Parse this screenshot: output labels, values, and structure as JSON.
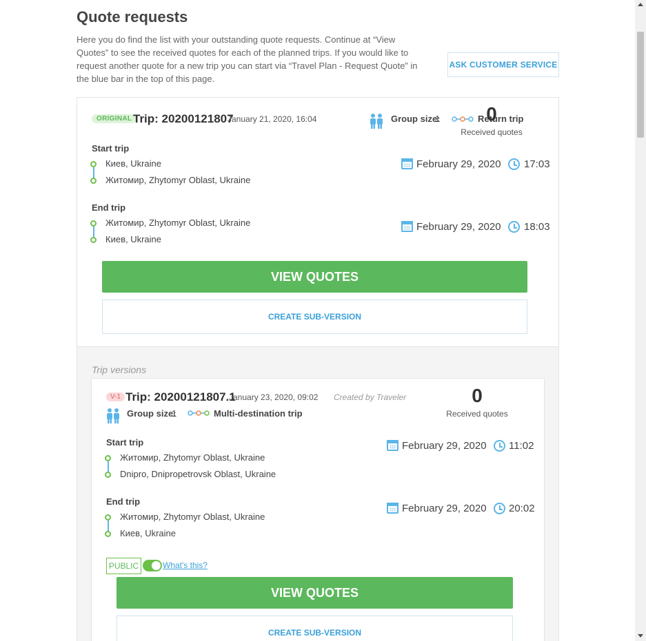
{
  "page": {
    "title": "Quote requests",
    "intro": "Here you do find the list with your outstanding quote requests. Continue at “View Quotes” to see the received quotes for each of the planned trips. If you would like to request another quote for a new trip you can start via “Travel Plan - Request Quote” in the blue bar in the top of this page.",
    "customer_service_label": "ASK CUSTOMER SERVICE"
  },
  "trip": {
    "badge": "ORIGINAL",
    "title": "Trip: 20200121807",
    "date": "January 21, 2020, 16:04",
    "group_size_label": "Group size:",
    "group_size_value": "1",
    "trip_type": "Return trip",
    "received_quotes_count": "0",
    "received_quotes_label": "Received quotes",
    "start": {
      "label": "Start trip",
      "stops": [
        "Киев, Ukraine",
        "Житомир, Zhytomyr Oblast, Ukraine"
      ],
      "date": "February 29, 2020",
      "time": "17:03"
    },
    "end": {
      "label": "End trip",
      "stops": [
        "Житомир, Zhytomyr Oblast, Ukraine",
        "Киев, Ukraine"
      ],
      "date": "February 29, 2020",
      "time": "18:03"
    },
    "view_quotes_label": "VIEW QUOTES",
    "create_sub_version_label": "CREATE SUB-VERSION"
  },
  "versions": {
    "label": "Trip versions",
    "items": [
      {
        "badge": "V-1",
        "title": "Trip: 20200121807.1",
        "date": "January 23, 2020, 09:02",
        "created_by": "Created by Traveler",
        "group_size_label": "Group size:",
        "group_size_value": "1",
        "trip_type": "Multi-destination trip",
        "received_quotes_count": "0",
        "received_quotes_label": "Received quotes",
        "start": {
          "label": "Start trip",
          "stops": [
            "Житомир, Zhytomyr Oblast, Ukraine",
            "Dnipro, Dnipropetrovsk Oblast, Ukraine"
          ],
          "date": "February 29, 2020",
          "time": "11:02"
        },
        "end": {
          "label": "End trip",
          "stops": [
            "Житомир, Zhytomyr Oblast, Ukraine",
            "Киев, Ukraine"
          ],
          "date": "February 29, 2020",
          "time": "20:02"
        },
        "public_label": "PUBLIC",
        "public_enabled": true,
        "whats_this_label": "What's this?",
        "view_quotes_label": "VIEW QUOTES",
        "create_sub_version_label": "CREATE SUB-VERSION"
      }
    ]
  },
  "colors": {
    "green": "#5cb85c",
    "blue": "#3aa0d8",
    "icon_blue": "#5bb5e8",
    "badge_red": "#e06565"
  }
}
